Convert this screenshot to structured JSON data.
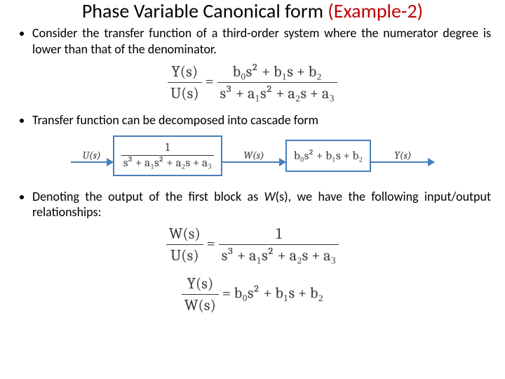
{
  "title": {
    "prefix": "Phase Variable Canonical form ",
    "suffix": "(Example-2)"
  },
  "bullets": {
    "b1": "Consider the transfer function of a third-order system where the numerator degree is lower than that of the denominator.",
    "b2": "Transfer function can be decomposed into cascade form",
    "b3_a": "Denoting the output of the first block as ",
    "b3_w": "W",
    "b3_s": "(s)",
    "b3_b": ", we have the following input/output relationships:"
  },
  "eq1": {
    "lhs_num": "Y(s)",
    "lhs_den": "U(s)",
    "eq": " = ",
    "num": "b₀s² + b₁s + b₂",
    "den": "s³ + a₁s² + a₂s + a₃"
  },
  "cascade": {
    "u": "U(s)",
    "w": "W(s)",
    "y": "Y(s)",
    "block1_num": "1",
    "block1_den": "s³ + a₁s² + a₂s + a₃",
    "block2": "b₀s² + b₁s + b₂"
  },
  "eq2": {
    "lhs_num": "W(s)",
    "lhs_den": "U(s)",
    "eq": " = ",
    "rhs_num": "1",
    "rhs_den": "s³ + a₁s² + a₂s + a₃"
  },
  "eq3": {
    "lhs_num": "Y(s)",
    "lhs_den": "W(s)",
    "eq": " = ",
    "rhs": "b₀s² + b₁s + b₂"
  }
}
